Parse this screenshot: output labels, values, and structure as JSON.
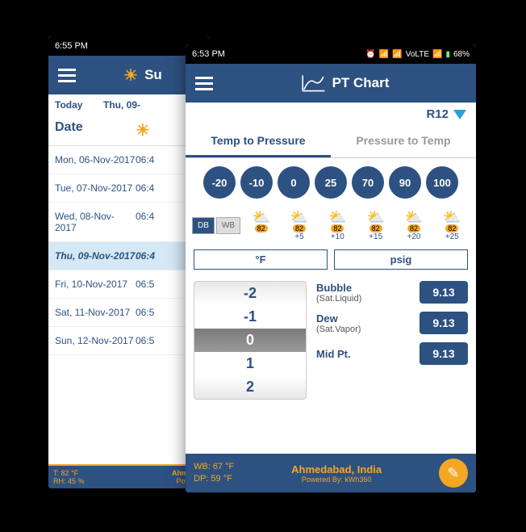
{
  "back": {
    "status_time": "6:55 PM",
    "header_title": "Su",
    "tab_today": "Today",
    "tab_date": "Thu, 09-",
    "col_date": "Date",
    "rows": [
      {
        "date": "Mon, 06-Nov-2017",
        "time": "06:4"
      },
      {
        "date": "Tue, 07-Nov-2017",
        "time": "06:4"
      },
      {
        "date": "Wed, 08-Nov-2017",
        "time": "06:4"
      },
      {
        "date": "Thu, 09-Nov-2017",
        "time": "06:4"
      },
      {
        "date": "Fri, 10-Nov-2017",
        "time": "06:5"
      },
      {
        "date": "Sat, 11-Nov-2017",
        "time": "06:5"
      },
      {
        "date": "Sun, 12-Nov-2017",
        "time": "06:5"
      }
    ],
    "footer_t": "T: 82 °F",
    "footer_rh": "RH: 45 %",
    "footer_loc": "Ahmedab",
    "footer_pow": "Powered"
  },
  "front": {
    "status_time": "6:53 PM",
    "status_volte": "VoLTE",
    "status_batt": "68%",
    "header_title": "PT Chart",
    "refrigerant": "R12",
    "tab1": "Temp to Pressure",
    "tab2": "Pressure to Temp",
    "chips": [
      "-20",
      "-10",
      "0",
      "25",
      "70",
      "90",
      "100"
    ],
    "db": "DB",
    "wb": "WB",
    "weather": [
      {
        "temp": "82",
        "off": ""
      },
      {
        "temp": "82",
        "off": "+5"
      },
      {
        "temp": "82",
        "off": "+10"
      },
      {
        "temp": "82",
        "off": "+15"
      },
      {
        "temp": "82",
        "off": "+20"
      },
      {
        "temp": "82",
        "off": "+25"
      }
    ],
    "unit_temp": "°F",
    "unit_press": "psig",
    "picker": [
      "-2",
      "-1",
      "0",
      "1",
      "2"
    ],
    "results": [
      {
        "label": "Bubble",
        "sub": "(Sat.Liquid)",
        "val": "9.13"
      },
      {
        "label": "Dew",
        "sub": "(Sat.Vapor)",
        "val": "9.13"
      },
      {
        "label": "Mid Pt.",
        "sub": "",
        "val": "9.13"
      }
    ],
    "footer_wb": "WB: 67 °F",
    "footer_dp": "DP: 59 °F",
    "footer_loc": "Ahmedabad, India",
    "footer_pow": "Powered By: kWh360"
  }
}
